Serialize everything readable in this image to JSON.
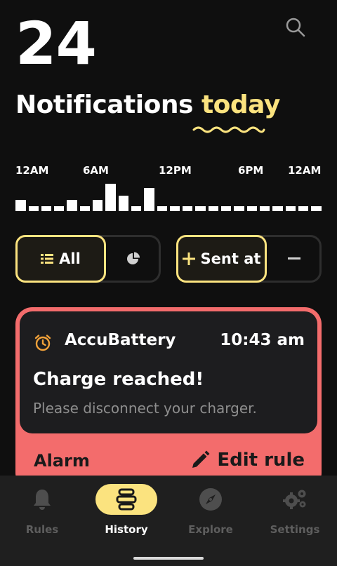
{
  "header": {
    "count": "24",
    "title_prefix": "Notifications",
    "title_highlight": "today"
  },
  "timeline": {
    "ticks": [
      "12AM",
      "6AM",
      "12PM",
      "6PM",
      "12AM"
    ]
  },
  "filters": {
    "all_label": "All",
    "sort_label": "Sent at"
  },
  "notification": {
    "app": "AccuBattery",
    "time": "10:43 am",
    "title": "Charge reached!",
    "body": "Please disconnect your charger.",
    "rule": "Alarm",
    "edit_label": "Edit rule"
  },
  "nav": {
    "items": [
      {
        "label": "Rules",
        "icon": "bell-icon"
      },
      {
        "label": "History",
        "icon": "history-icon"
      },
      {
        "label": "Explore",
        "icon": "compass-icon"
      },
      {
        "label": "Settings",
        "icon": "gears-icon"
      }
    ],
    "active": "History"
  },
  "colors": {
    "accent": "#fbe37f",
    "card": "#f36c6c",
    "background": "#0f0f0f"
  }
}
